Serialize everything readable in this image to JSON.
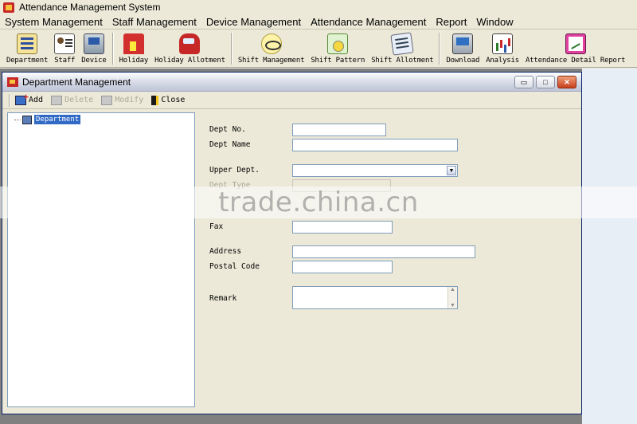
{
  "app": {
    "title": "Attendance Management System"
  },
  "menu": [
    "System Management",
    "Staff Management",
    "Device Management",
    "Attendance Management",
    "Report",
    "Window"
  ],
  "toolbar": {
    "group1": [
      {
        "label": "Department",
        "icon": "department-icon"
      },
      {
        "label": "Staff",
        "icon": "staff-icon"
      },
      {
        "label": "Device",
        "icon": "device-icon"
      }
    ],
    "group2": [
      {
        "label": "Holiday",
        "icon": "holiday-icon"
      },
      {
        "label": "Holiday Allotment",
        "icon": "holiday-allotment-icon"
      }
    ],
    "group3": [
      {
        "label": "Shift Management",
        "icon": "shift-management-icon"
      },
      {
        "label": "Shift Pattern",
        "icon": "shift-pattern-icon"
      },
      {
        "label": "Shift Allotment",
        "icon": "shift-allotment-icon"
      }
    ],
    "group4": [
      {
        "label": "Download",
        "icon": "download-icon"
      },
      {
        "label": "Analysis",
        "icon": "analysis-icon"
      },
      {
        "label": "Attendance Detail Report",
        "icon": "attendance-detail-report-icon"
      }
    ]
  },
  "window": {
    "title": "Department Management",
    "buttons": {
      "minimize": "▭",
      "maximize": "□",
      "close": "✕"
    },
    "toolbar": {
      "add": "Add",
      "delete": "Delete",
      "modify": "Modify",
      "close": "Close"
    },
    "tree": {
      "root": "Department"
    },
    "form": {
      "dept_no": {
        "label": "Dept No.",
        "value": ""
      },
      "dept_name": {
        "label": "Dept Name",
        "value": ""
      },
      "upper_dept": {
        "label": "Upper Dept.",
        "value": ""
      },
      "dept_type": {
        "label": "Dept Type",
        "value": ""
      },
      "fax": {
        "label": "Fax",
        "value": ""
      },
      "address": {
        "label": "Address",
        "value": ""
      },
      "postal_code": {
        "label": "Postal Code",
        "value": ""
      },
      "remark": {
        "label": "Remark",
        "value": ""
      }
    }
  },
  "watermark": "trade.china.cn",
  "colors": {
    "selection": "#316ac5",
    "window_border": "#0a246a",
    "face": "#ece9d8"
  }
}
